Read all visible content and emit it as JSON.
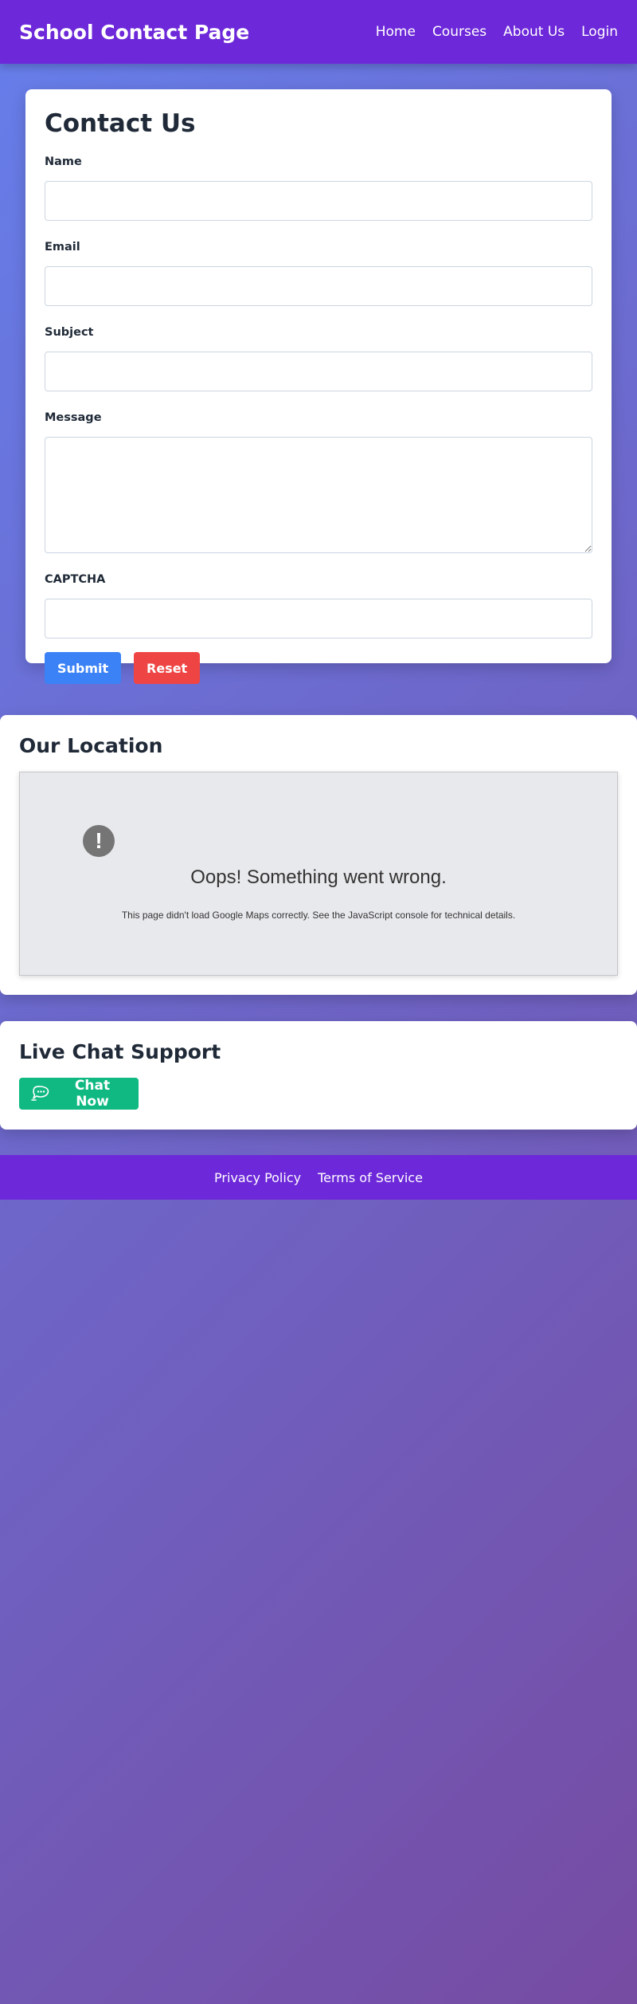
{
  "header": {
    "title": "School Contact Page",
    "nav": [
      "Home",
      "Courses",
      "About Us",
      "Login"
    ]
  },
  "contact_form": {
    "heading": "Contact Us",
    "fields": {
      "name_label": "Name",
      "email_label": "Email",
      "subject_label": "Subject",
      "message_label": "Message",
      "captcha_label": "CAPTCHA"
    },
    "submit_label": "Submit",
    "reset_label": "Reset"
  },
  "location": {
    "heading": "Our Location",
    "map_error_title": "Oops! Something went wrong.",
    "map_error_detail": "This page didn't load Google Maps correctly. See the JavaScript console for technical details."
  },
  "chat": {
    "heading": "Live Chat Support",
    "button_label": "Chat Now",
    "icon": "chat-bubble-icon"
  },
  "footer": {
    "links": [
      "Privacy Policy",
      "Terms of Service"
    ]
  },
  "colors": {
    "header_bg": "#6d28d9",
    "submit": "#3b82f6",
    "reset": "#ef4444",
    "chat": "#10b981"
  }
}
